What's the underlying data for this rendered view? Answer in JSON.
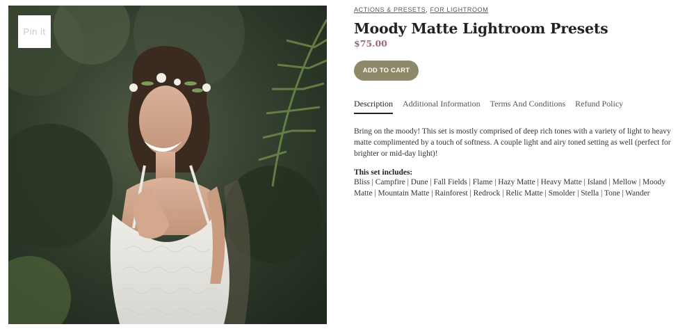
{
  "image": {
    "pin_label": "Pin it",
    "alt": "Bride in lace dress with flower crown"
  },
  "breadcrumb": {
    "items": [
      "ACTIONS & PRESETS",
      "FOR LIGHTROOM"
    ],
    "separator": ", "
  },
  "product": {
    "title": "Moody Matte Lightroom Presets",
    "price": "$75.00",
    "add_to_cart_label": "ADD TO CART"
  },
  "tabs": [
    {
      "label": "Description",
      "active": true
    },
    {
      "label": "Additional Information",
      "active": false
    },
    {
      "label": "Terms And Conditions",
      "active": false
    },
    {
      "label": "Refund Policy",
      "active": false
    }
  ],
  "description": {
    "text": "Bring on the moody!  This set is mostly comprised of deep rich tones with a variety of light to heavy matte complimented by a touch of softness.  A couple light and airy toned setting as well (perfect for brighter or mid-day light)!",
    "includes_heading": "This set includes:",
    "includes_text": "Bliss | Campfire  |  Dune  |  Fall Fields  |  Flame  |  Hazy Matte  |  Heavy Matte  |  Island  |  Mellow  |  Moody Matte  |  Mountain Matte  |  Rainforest  |  Redrock  |  Relic Matte  |  Smolder  |  Stella   |  Tone  |  Wander"
  },
  "colors": {
    "button_bg": "#8e8a69",
    "price": "#9b6874",
    "active_tab_underline": "#222222"
  }
}
